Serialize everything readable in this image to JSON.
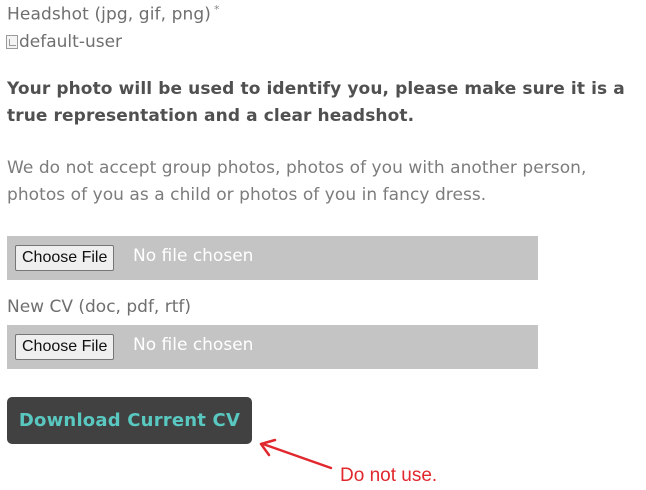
{
  "form": {
    "headshot": {
      "label": "Headshot (jpg, gif, png)",
      "required_marker": "*",
      "image_alt": "default-user",
      "choose_button": "Choose File",
      "status": "No file chosen"
    },
    "notice_bold": "Your photo will be used to identify you, please make sure it is a true representation and a clear headshot.",
    "notice_plain": "We do not accept group photos, photos of you with another person, photos of you as a child or photos of you in fancy dress.",
    "cv": {
      "label": "New CV (doc, pdf, rtf)",
      "choose_button": "Choose File",
      "status": "No file chosen"
    },
    "download_button": "Download Current CV"
  },
  "annotation": {
    "text": "Do not use.",
    "color": "#e0282e"
  },
  "colors": {
    "button_bg": "#414141",
    "button_text": "#59c8c0",
    "file_box_bg": "#c4c4c4"
  }
}
